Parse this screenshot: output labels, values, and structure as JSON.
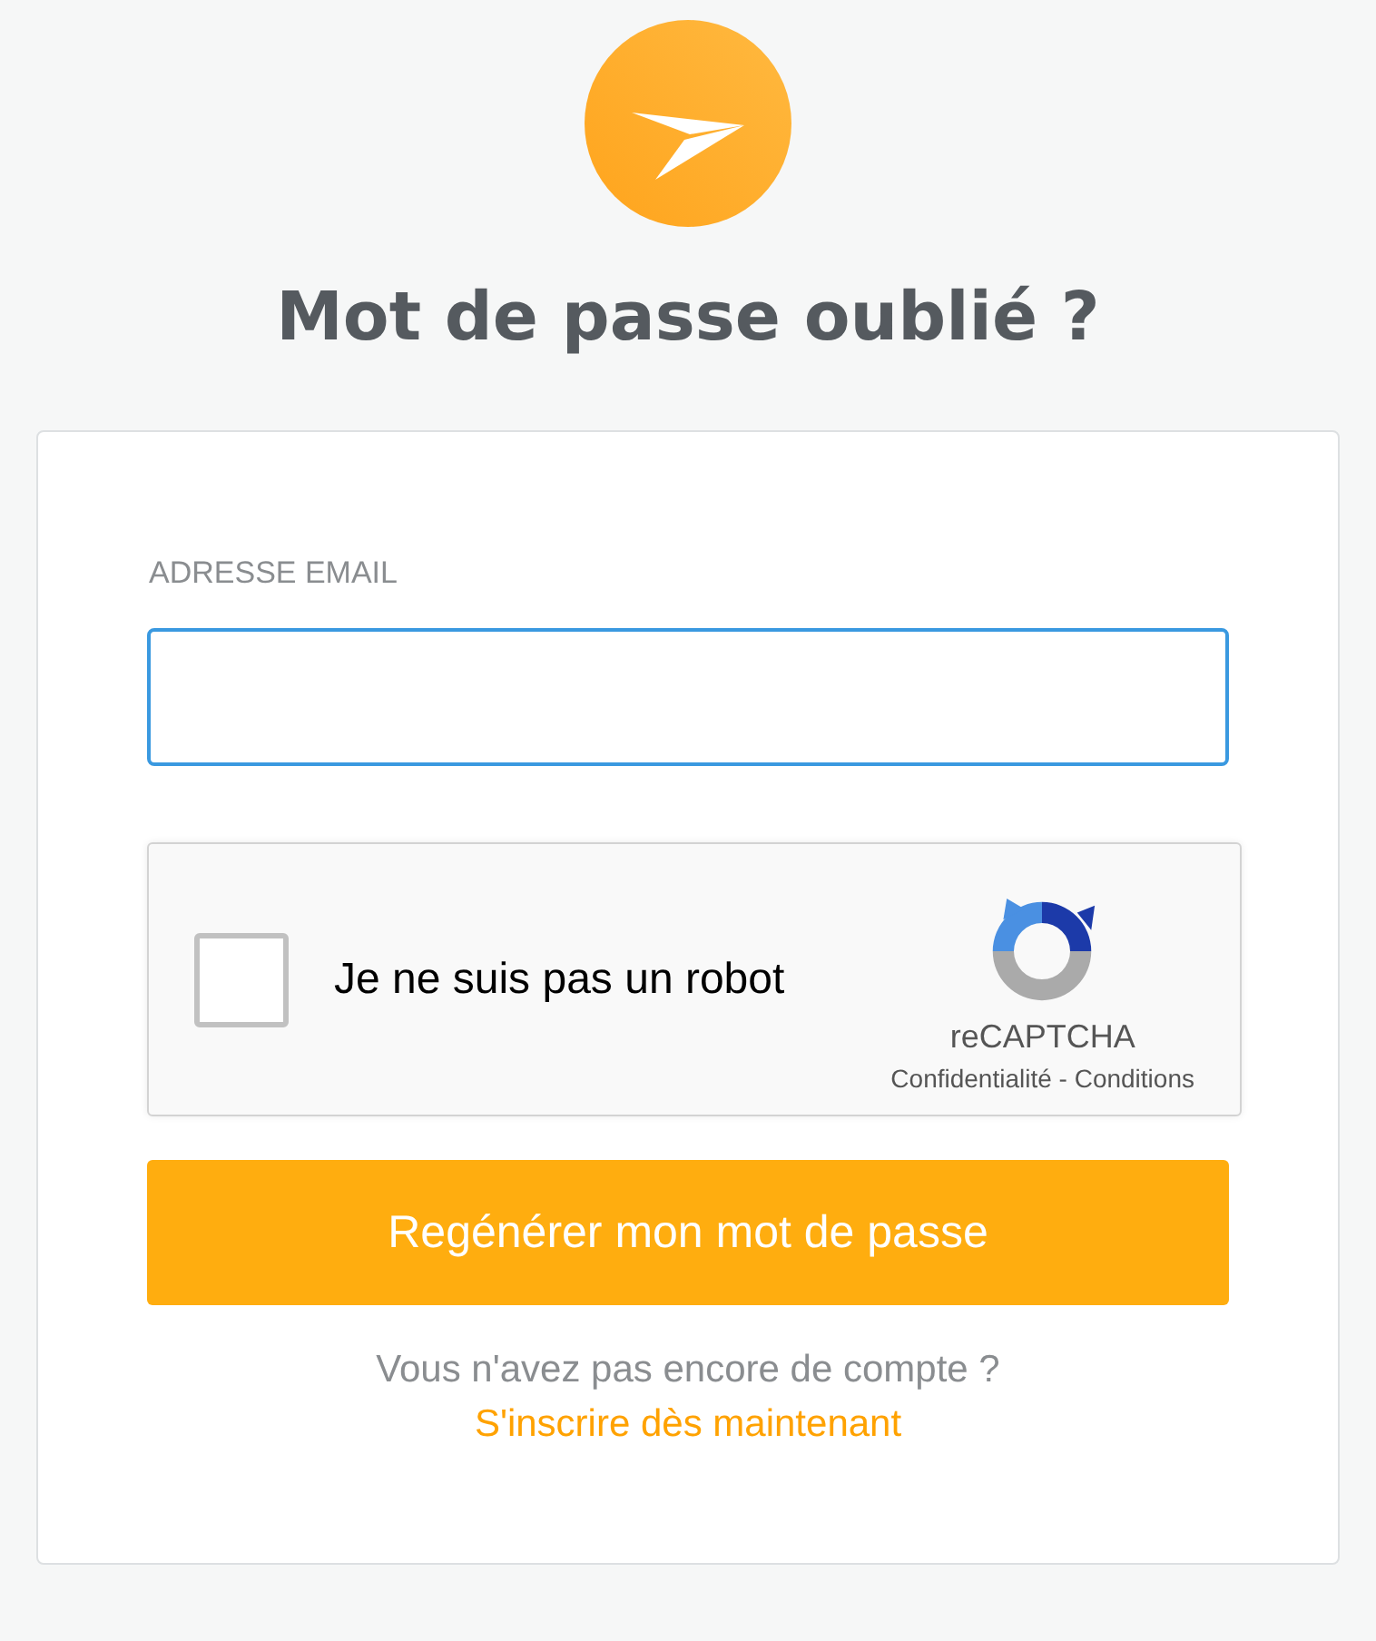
{
  "title": "Mot de passe oublié ?",
  "email_field": {
    "label": "ADRESSE EMAIL",
    "focused": true
  },
  "captcha": {
    "label": "Je ne suis pas un robot",
    "checked": false,
    "brand": "reCAPTCHA",
    "links": "Confidentialité - Conditions"
  },
  "submit_button": "Regénérer mon mot de passe",
  "footer": {
    "question": "Vous n'avez pas encore de compte ?",
    "link": "S'inscrire dès maintenant"
  }
}
